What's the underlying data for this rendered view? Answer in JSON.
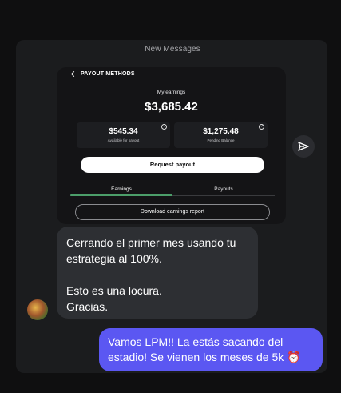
{
  "divider": {
    "label": "New Messages"
  },
  "card": {
    "title": "PAYOUT METHODS",
    "earnings_label": "My earnings",
    "earnings_value": "$3,685.42",
    "stats": [
      {
        "value": "$545.34",
        "label": "Available for payout"
      },
      {
        "value": "$1,275.48",
        "label": "Pending Balance"
      }
    ],
    "help_glyph": "?",
    "request_button": "Request payout",
    "tabs": [
      {
        "label": "Earnings",
        "active": true
      },
      {
        "label": "Payouts",
        "active": false
      }
    ],
    "download_button": "Download earnings report"
  },
  "messages": {
    "incoming": "Cerrando el primer mes usando tu estrategia al 100%.\n\nEsto es una locura.\nGracias.",
    "outgoing": "Vamos LPM!! La estás sacando del estadio! Se vienen los meses de 5k ⏰"
  },
  "colors": {
    "accent": "#5b57f2",
    "tab_active": "#4c9e6a",
    "bubble_in": "#2d2f33"
  },
  "icons": {
    "send": "send-icon",
    "back": "chevron-left-icon",
    "help": "help-circle-icon"
  }
}
